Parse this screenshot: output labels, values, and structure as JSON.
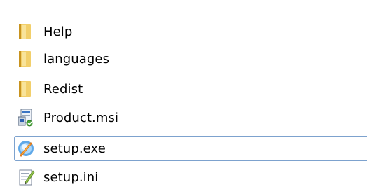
{
  "files": [
    {
      "name": "Help",
      "icon": "folder-icon",
      "selected": false
    },
    {
      "name": "languages",
      "icon": "folder-icon",
      "selected": false
    },
    {
      "name": "Redist",
      "icon": "folder-icon",
      "selected": false
    },
    {
      "name": "Product.msi",
      "icon": "msi-installer-icon",
      "selected": false
    },
    {
      "name": "setup.exe",
      "icon": "setup-exe-icon",
      "selected": true
    },
    {
      "name": "setup.ini",
      "icon": "ini-file-icon",
      "selected": false
    }
  ],
  "colors": {
    "selection_border": "#7da2ce",
    "folder": "#e8c050",
    "background": "#ffffff"
  }
}
